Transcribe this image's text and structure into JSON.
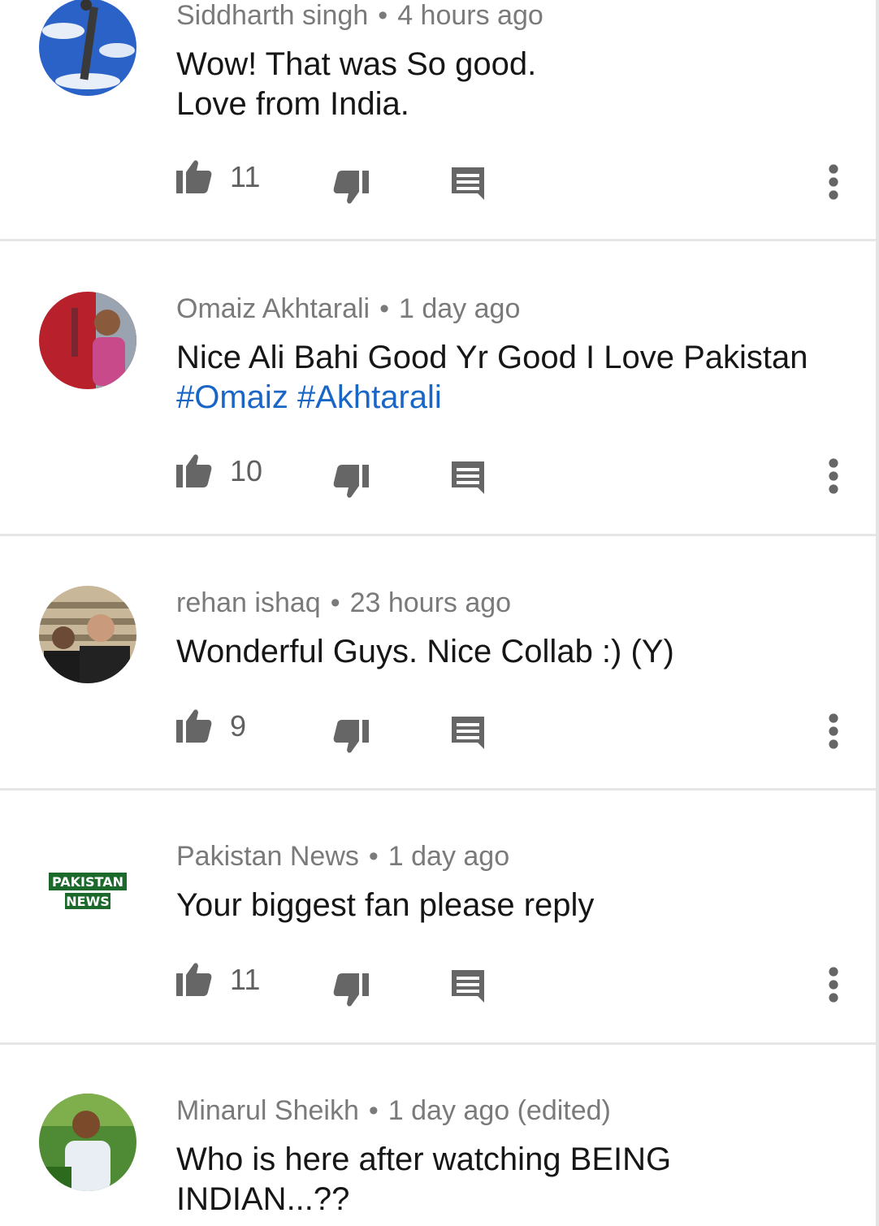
{
  "comments": [
    {
      "author": "Siddharth singh",
      "separator": "•",
      "time": "4 hours ago",
      "lines": [
        "Wow! That was So good.",
        "Love from India."
      ],
      "hashtags": [],
      "likes": "11"
    },
    {
      "author": "Omaiz Akhtarali",
      "separator": "•",
      "time": "1 day ago",
      "lines": [
        "Nice Ali Bahi Good Yr Good  I Love Pakistan"
      ],
      "hashtags": [
        "#Omaiz",
        "#Akhtarali"
      ],
      "likes": "10"
    },
    {
      "author": "rehan ishaq",
      "separator": "•",
      "time": "23 hours ago",
      "lines": [
        "Wonderful Guys. Nice Collab  :) (Y)"
      ],
      "hashtags": [],
      "likes": "9"
    },
    {
      "author": "Pakistan News",
      "separator": "•",
      "time": "1 day ago",
      "lines": [
        "Your biggest fan please reply"
      ],
      "hashtags": [],
      "likes": "11",
      "avatar_logo": [
        "PAKISTAN",
        "NEWS"
      ]
    },
    {
      "author": "Minarul Sheikh",
      "separator": "•",
      "time": "1 day ago (edited)",
      "lines": [
        "Who is here after watching BEING",
        "INDIAN...??"
      ],
      "hashtags": [],
      "likes": ""
    }
  ],
  "icons": {
    "like": "thumbs-up-icon",
    "dislike": "thumbs-down-icon",
    "reply": "comment-icon",
    "menu": "more-vert-icon"
  },
  "colors": {
    "author_meta": "#7a7a7a",
    "body_text": "#161616",
    "hashtag": "#1a66c7",
    "action_icon": "#666666",
    "divider": "#e6e6e6"
  }
}
